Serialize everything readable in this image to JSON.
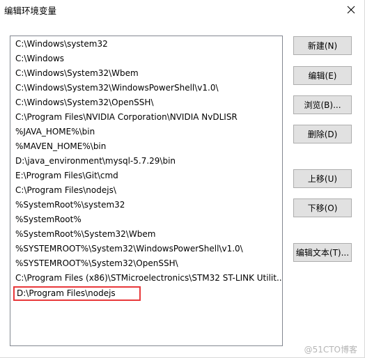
{
  "window": {
    "title": "编辑环境变量"
  },
  "path_list": {
    "items": [
      "C:\\Windows\\system32",
      "C:\\Windows",
      "C:\\Windows\\System32\\Wbem",
      "C:\\Windows\\System32\\WindowsPowerShell\\v1.0\\",
      "C:\\Windows\\System32\\OpenSSH\\",
      "C:\\Program Files\\NVIDIA Corporation\\NVIDIA NvDLISR",
      "%JAVA_HOME%\\bin",
      "%MAVEN_HOME%\\bin",
      "D:\\java_environment\\mysql-5.7.29\\bin",
      "E:\\Program Files\\Git\\cmd",
      "C:\\Program Files\\nodejs\\",
      "%SystemRoot%\\system32",
      "%SystemRoot%",
      "%SystemRoot%\\System32\\Wbem",
      "%SYSTEMROOT%\\System32\\WindowsPowerShell\\v1.0\\",
      "%SYSTEMROOT%\\System32\\OpenSSH\\",
      "C:\\Program Files (x86)\\STMicroelectronics\\STM32 ST-LINK Utilit..."
    ],
    "editing_value": "D:\\Program Files\\nodejs"
  },
  "buttons": {
    "new": "新建(N)",
    "edit": "编辑(E)",
    "browse": "浏览(B)...",
    "delete": "删除(D)",
    "move_up": "上移(U)",
    "move_down": "下移(O)",
    "edit_text": "编辑文本(T)..."
  },
  "watermark": "@51CTO博客",
  "colors": {
    "highlight_border": "#e8383a",
    "button_face": "#e1e1e1"
  }
}
